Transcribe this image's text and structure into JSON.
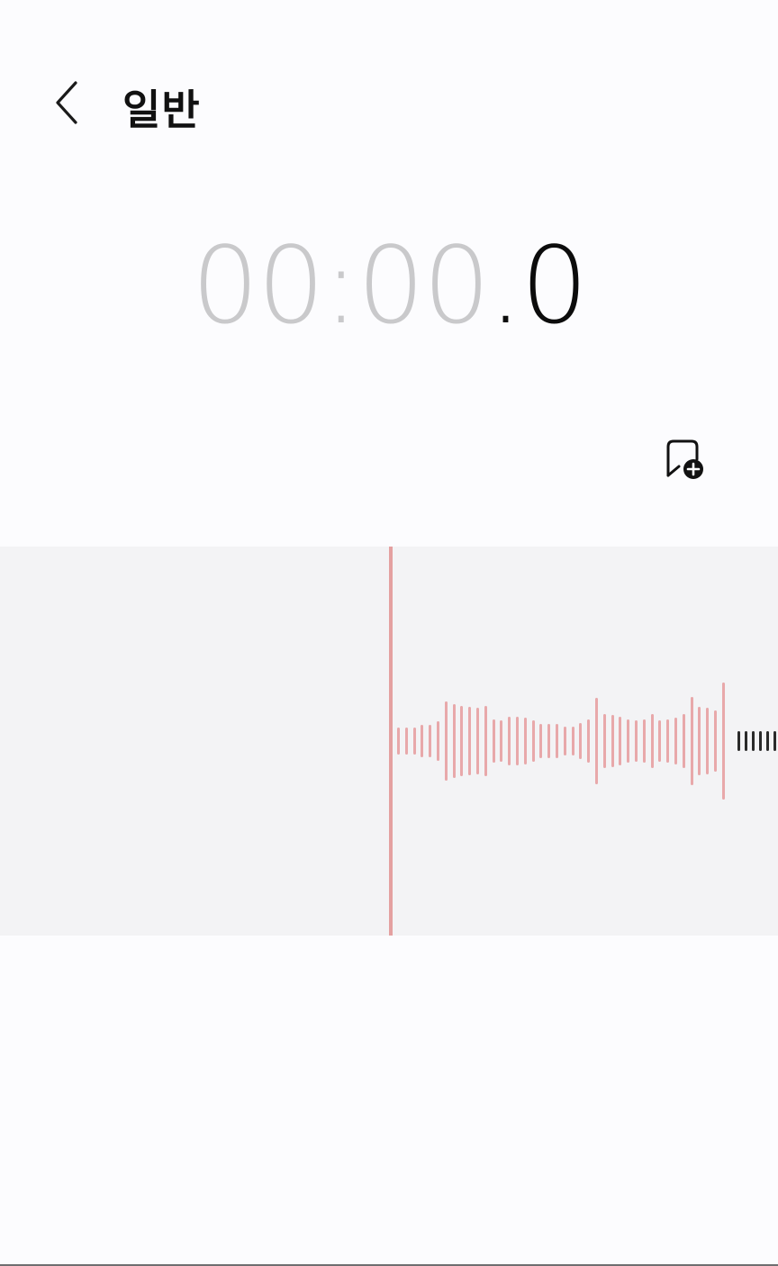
{
  "header": {
    "title": "일반"
  },
  "timer": {
    "minutes": "00",
    "sep1": ":",
    "seconds": "00",
    "sep2": ".",
    "tenths": "0"
  },
  "colors": {
    "recorded_wave": "#e8a8aa",
    "pending_wave": "#2a2a2a",
    "playhead": "#e4a0a0",
    "panel_bg": "#f3f3f5"
  },
  "icons": {
    "back": "chevron-left-icon",
    "bookmark": "bookmark-add-icon"
  },
  "waveform": {
    "recorded_levels": [
      0.22,
      0.22,
      0.22,
      0.26,
      0.26,
      0.32,
      0.64,
      0.6,
      0.58,
      0.56,
      0.54,
      0.58,
      0.36,
      0.34,
      0.4,
      0.4,
      0.38,
      0.34,
      0.28,
      0.28,
      0.28,
      0.24,
      0.24,
      0.3,
      0.36,
      0.7,
      0.44,
      0.42,
      0.4,
      0.36,
      0.34,
      0.36,
      0.44,
      0.34,
      0.36,
      0.38,
      0.44,
      0.72,
      0.56,
      0.54,
      0.5,
      0.96
    ],
    "pending_levels": [
      0.16,
      0.16,
      0.16,
      0.16,
      0.16,
      0.16,
      0.16,
      0.16,
      0.16
    ]
  }
}
